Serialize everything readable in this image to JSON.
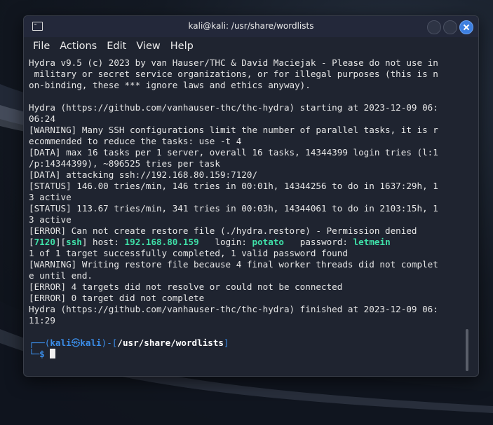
{
  "window": {
    "title": "kali@kali: /usr/share/wordlists"
  },
  "menu": [
    "File",
    "Actions",
    "Edit",
    "View",
    "Help"
  ],
  "terminal": {
    "lines": [
      "Hydra v9.5 (c) 2023 by van Hauser/THC & David Maciejak - Please do not use in",
      " military or secret service organizations, or for illegal purposes (this is n",
      "on-binding, these *** ignore laws and ethics anyway).",
      "",
      "Hydra (https://github.com/vanhauser-thc/thc-hydra) starting at 2023-12-09 06:",
      "06:24",
      "[WARNING] Many SSH configurations limit the number of parallel tasks, it is r",
      "ecommended to reduce the tasks: use -t 4",
      "[DATA] max 16 tasks per 1 server, overall 16 tasks, 14344399 login tries (l:1",
      "/p:14344399), ~896525 tries per task",
      "[DATA] attacking ssh://192.168.80.159:7120/",
      "[STATUS] 146.00 tries/min, 146 tries in 00:01h, 14344256 to do in 1637:29h, 1",
      "3 active",
      "[STATUS] 113.67 tries/min, 341 tries in 00:03h, 14344061 to do in 2103:15h, 1",
      "3 active",
      "[ERROR] Can not create restore file (./hydra.restore) - Permission denied"
    ],
    "found": {
      "port": "7120",
      "service": "ssh",
      "host_label": " host: ",
      "host": "192.168.80.159",
      "login_label": "   login: ",
      "login": "potato",
      "password_label": "   password: ",
      "password": "letmein"
    },
    "lines_after": [
      "1 of 1 target successfully completed, 1 valid password found",
      "[WARNING] Writing restore file because 4 final worker threads did not complet",
      "e until end.",
      "[ERROR] 4 targets did not resolve or could not be connected",
      "[ERROR] 0 target did not complete",
      "Hydra (https://github.com/vanhauser-thc/thc-hydra) finished at 2023-12-09 06:",
      "11:29",
      ""
    ],
    "prompt": {
      "corner_top": "┌──(",
      "user": "kali",
      "at": "㉿",
      "host": "kali",
      "mid": ")-[",
      "path": "/usr/share/wordlists",
      "end": "]",
      "corner_bottom": "└─",
      "symbol": "$ "
    }
  },
  "colors": {
    "accent_blue": "#3b8eea",
    "highlight_green": "#3fe0a8",
    "close_button": "#3d7fe0"
  }
}
